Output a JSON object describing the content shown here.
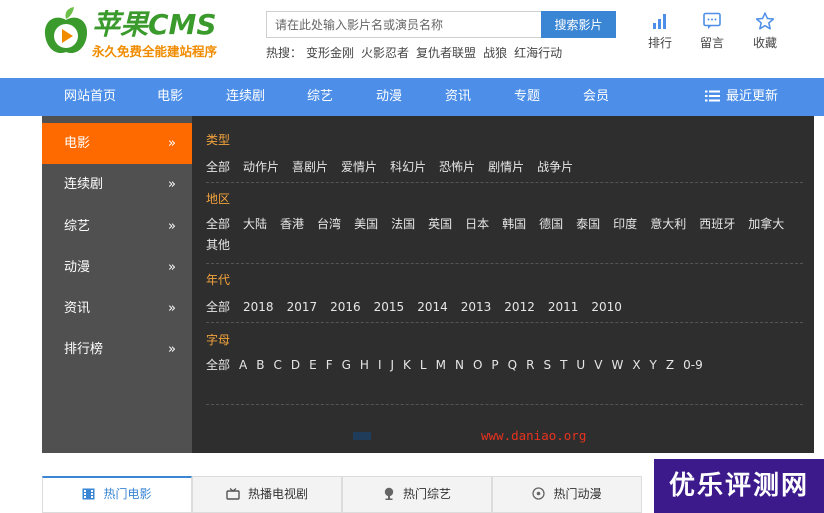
{
  "brand": {
    "title": "苹果CMS",
    "subtitle": "永久免费全能建站程序",
    "green": "#3a9a2c",
    "orange": "#f08c00"
  },
  "search": {
    "placeholder": "请在此处输入影片名或演员名称",
    "button": "搜索影片"
  },
  "hot": {
    "label": "热搜：",
    "items": [
      "变形金刚",
      "火影忍者",
      "复仇者联盟",
      "战狼",
      "红海行动"
    ]
  },
  "tools": [
    {
      "label": "排行",
      "icon": "bar-chart-icon"
    },
    {
      "label": "留言",
      "icon": "message-icon"
    },
    {
      "label": "收藏",
      "icon": "star-icon"
    }
  ],
  "nav": {
    "items": [
      "网站首页",
      "电影",
      "连续剧",
      "综艺",
      "动漫",
      "资讯",
      "专题",
      "会员"
    ],
    "recent": "最近更新",
    "color": "#4d8fe8"
  },
  "sidebar": {
    "items": [
      {
        "label": "电影",
        "arrow": "»",
        "active": true
      },
      {
        "label": "连续剧",
        "arrow": "»"
      },
      {
        "label": "综艺",
        "arrow": "»"
      },
      {
        "label": "动漫",
        "arrow": "»"
      },
      {
        "label": "资讯",
        "arrow": "»"
      },
      {
        "label": "排行榜",
        "arrow": "»"
      }
    ],
    "active_color": "#ff6a00"
  },
  "filters": {
    "type": {
      "title": "类型",
      "items": [
        "全部",
        "动作片",
        "喜剧片",
        "爱情片",
        "科幻片",
        "恐怖片",
        "剧情片",
        "战争片"
      ]
    },
    "area": {
      "title": "地区",
      "items": [
        "全部",
        "大陆",
        "香港",
        "台湾",
        "美国",
        "法国",
        "英国",
        "日本",
        "韩国",
        "德国",
        "泰国",
        "印度",
        "意大利",
        "西班牙",
        "加拿大",
        "其他"
      ]
    },
    "year": {
      "title": "年代",
      "items": [
        "全部",
        "2018",
        "2017",
        "2016",
        "2015",
        "2014",
        "2013",
        "2012",
        "2011",
        "2010"
      ]
    },
    "letter": {
      "title": "字母",
      "items": [
        "全部",
        "A",
        "B",
        "C",
        "D",
        "E",
        "F",
        "G",
        "H",
        "I",
        "J",
        "K",
        "L",
        "M",
        "N",
        "O",
        "P",
        "Q",
        "R",
        "S",
        "T",
        "U",
        "V",
        "W",
        "X",
        "Y",
        "Z",
        "0-9"
      ]
    }
  },
  "watermark": "www.daniao.org",
  "tabs": [
    {
      "label": "热门电影",
      "icon": "film-icon",
      "active": true
    },
    {
      "label": "热播电视剧",
      "icon": "tv-icon"
    },
    {
      "label": "热门综艺",
      "icon": "mic-icon"
    },
    {
      "label": "热门动漫",
      "icon": "disc-icon"
    }
  ],
  "badge": {
    "text": "优乐评测网",
    "color": "#3c1a8c"
  }
}
